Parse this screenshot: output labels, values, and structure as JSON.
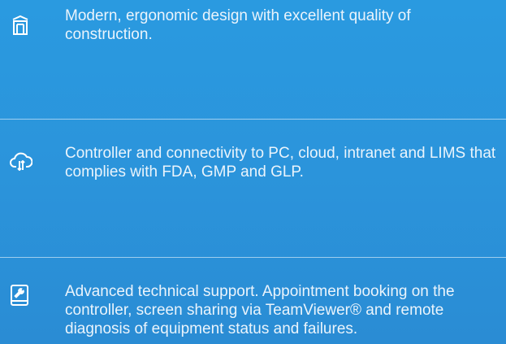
{
  "features": [
    {
      "icon": "cabinet-icon",
      "text": "Modern, ergonomic design with excellent quality of construction."
    },
    {
      "icon": "cloud-sync-icon",
      "text": "Controller and connectivity to PC, cloud, intranet and LIMS that complies with FDA, GMP and GLP."
    },
    {
      "icon": "tablet-wrench-icon",
      "text": "Advanced technical support. Appointment booking on the controller, screen sharing via TeamViewer® and remote diagnosis of equipment status and failures."
    }
  ],
  "colors": {
    "background": "#2b94db",
    "text": "#eaf4fc",
    "divider": "#ffffff"
  }
}
